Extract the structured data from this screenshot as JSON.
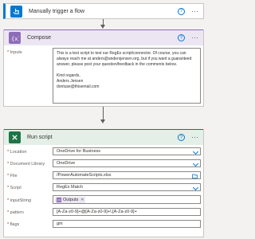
{
  "trigger": {
    "title": "Manually trigger a flow",
    "help": "?",
    "more": "···",
    "color": "#0078d4"
  },
  "compose": {
    "title": "Compose",
    "help": "?",
    "more": "···",
    "color": "#8c6cb7",
    "inputs_label": "Inputs",
    "text_lines": [
      "This is a test script to test our RegEx script/connector. Of course, you can",
      "always reach me at anders@andersjensen.org, but if you want a guaranteed",
      "answer, please post your question/feedback in the comments below.",
      "",
      "Kind regards,",
      "Anders Jensen",
      "dontuse@thisemail.com"
    ]
  },
  "runscript": {
    "title": "Run script",
    "help": "?",
    "more": "···",
    "color": "#217346",
    "location_label": "Location",
    "location_value": "OneDrive for Business",
    "doclib_label": "Document Library",
    "doclib_value": "OneDrive",
    "file_label": "File",
    "file_value": "/PowerAutomateScripts.xlsx",
    "script_label": "Script",
    "script_value": "RegEx Match",
    "inputstring_label": "inputString",
    "inputstring_token": "Outputs",
    "pattern_label": "pattern",
    "pattern_value": "[A-Za-z0-9]+@[A-Za-z0-9]+\\.[A-Za-z0-9]+",
    "flags_label": "flags",
    "flags_value": "gm"
  }
}
